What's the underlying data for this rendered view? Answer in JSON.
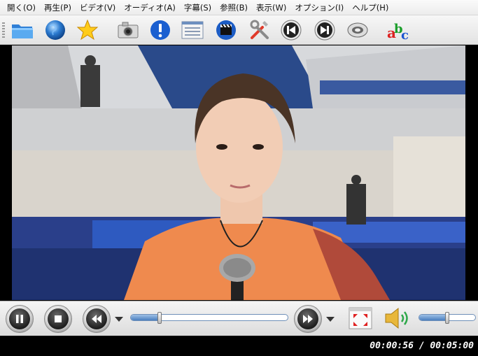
{
  "menu": {
    "items": [
      {
        "label": "開く(O)"
      },
      {
        "label": "再生(P)"
      },
      {
        "label": "ビデオ(V)"
      },
      {
        "label": "オーディオ(A)"
      },
      {
        "label": "字幕(S)"
      },
      {
        "label": "参照(B)"
      },
      {
        "label": "表示(W)"
      },
      {
        "label": "オプション(I)"
      },
      {
        "label": "ヘルプ(H)"
      }
    ]
  },
  "toolbar": {
    "icons": [
      "folder-icon",
      "globe-icon",
      "star-favorites-icon",
      "camera-screenshot-icon",
      "info-icon",
      "playlist-icon",
      "clapperboard-icon",
      "tools-preferences-icon",
      "previous-track-icon",
      "next-track-icon",
      "disc-icon",
      "subtitle-abc-icon"
    ]
  },
  "controls": {
    "seek_fraction": 0.187,
    "volume_fraction": 0.5,
    "accent_color": "#4a7fc0"
  },
  "status": {
    "time": "00:00:56 / 00:05:00"
  }
}
